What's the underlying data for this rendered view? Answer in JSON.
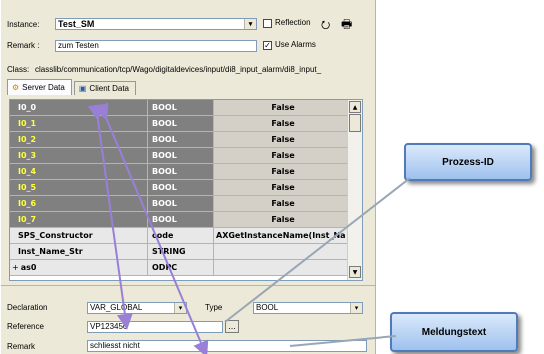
{
  "instance": {
    "label": "Instance:",
    "value": "Test_SM"
  },
  "reflection": {
    "label": "Reflection",
    "checked": false
  },
  "remark_top": {
    "label": "Remark :",
    "value": "zum Testen"
  },
  "use_alarms": {
    "label": "Use Alarms",
    "checked": true
  },
  "class_info": {
    "label": "Class:",
    "value": "classlib/communication/tcp/Wago/digitaldevices/input/di8_input_alarm/di8_input_"
  },
  "tabs": [
    {
      "label": "Server Data",
      "icon": "server-icon"
    },
    {
      "label": "Client Data",
      "icon": "client-icon"
    }
  ],
  "grid_rows": [
    {
      "name": "I0_0",
      "type": "BOOL",
      "value": "False"
    },
    {
      "name": "I0_1",
      "type": "BOOL",
      "value": "False"
    },
    {
      "name": "I0_2",
      "type": "BOOL",
      "value": "False"
    },
    {
      "name": "I0_3",
      "type": "BOOL",
      "value": "False"
    },
    {
      "name": "I0_4",
      "type": "BOOL",
      "value": "False"
    },
    {
      "name": "I0_5",
      "type": "BOOL",
      "value": "False"
    },
    {
      "name": "I0_6",
      "type": "BOOL",
      "value": "False"
    },
    {
      "name": "I0_7",
      "type": "BOOL",
      "value": "False"
    },
    {
      "name": "SPS_Constructor",
      "type": "code",
      "value": "AXGetInstanceName(Inst_Na"
    },
    {
      "name": "Inst_Name_Str",
      "type": "STRING",
      "value": ""
    },
    {
      "name": "as0",
      "type": "ODPC",
      "value": "",
      "expander": "+"
    }
  ],
  "declaration": {
    "label": "Declaration",
    "value": "VAR_GLOBAL"
  },
  "type_field": {
    "label": "Type",
    "value": "BOOL"
  },
  "reference": {
    "label": "Reference",
    "value": "VP123456",
    "browse": "..."
  },
  "remark_bottom": {
    "label": "Remark",
    "value": "schliesst nicht"
  },
  "callouts": {
    "prozess_id": "Prozess-ID",
    "meldungstext": "Meldungstext"
  },
  "colors": {
    "panel": "#ece9d8",
    "arrow": "#9a7fd6",
    "callout_border": "#4f7bb8"
  }
}
